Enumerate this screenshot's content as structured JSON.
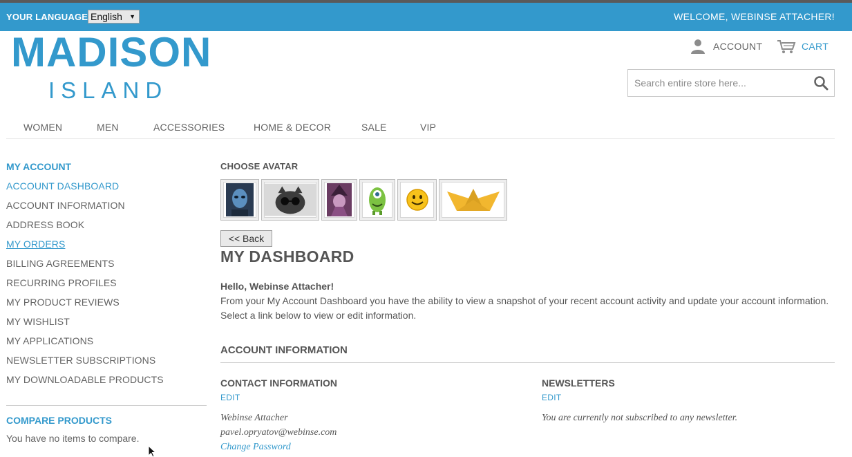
{
  "topbar": {
    "language_label": "YOUR LANGUAGE:",
    "language_selected": "English",
    "welcome": "WELCOME, WEBINSE ATTACHER!"
  },
  "logo": {
    "line1": "MADISON",
    "line2": "ISLAND"
  },
  "header": {
    "account_label": "ACCOUNT",
    "cart_label": "CART",
    "search_placeholder": "Search entire store here..."
  },
  "nav": {
    "items": [
      "WOMEN",
      "MEN",
      "ACCESSORIES",
      "HOME & DECOR",
      "SALE",
      "VIP"
    ]
  },
  "sidebar": {
    "title": "MY ACCOUNT",
    "items": [
      "ACCOUNT DASHBOARD",
      "ACCOUNT INFORMATION",
      "ADDRESS BOOK",
      "MY ORDERS",
      "BILLING AGREEMENTS",
      "RECURRING PROFILES",
      "MY PRODUCT REVIEWS",
      "MY WISHLIST",
      "MY APPLICATIONS",
      "NEWSLETTER SUBSCRIPTIONS",
      "MY DOWNLOADABLE PRODUCTS"
    ],
    "active_item": "ACCOUNT DASHBOARD",
    "hovered_item": "MY ORDERS",
    "compare_title": "COMPARE PRODUCTS",
    "compare_empty": "You have no items to compare."
  },
  "main": {
    "avatar_title": "CHOOSE AVATAR",
    "avatars": [
      "blue-alien-avatar",
      "cat-with-sunglasses-avatar",
      "purple-witch-avatar",
      "green-cyclops-avatar",
      "yellow-smiley-avatar",
      "paper-boat-avatar"
    ],
    "back_label": "<< Back",
    "page_title": "MY DASHBOARD",
    "hello": "Hello, Webinse Attacher!",
    "intro": "From your My Account Dashboard you have the ability to view a snapshot of your recent account activity and update your account information. Select a link below to view or edit information.",
    "section_title": "ACCOUNT INFORMATION",
    "contact": {
      "title": "CONTACT INFORMATION",
      "edit": "EDIT",
      "name": "Webinse Attacher",
      "email": "pavel.opryatov@webinse.com",
      "change_password": "Change Password"
    },
    "newsletters": {
      "title": "NEWSLETTERS",
      "edit": "EDIT",
      "status": "You are currently not subscribed to any newsletter."
    }
  },
  "colors": {
    "brand": "#3399cc",
    "text": "#636363",
    "topbar": "#3399cc"
  }
}
